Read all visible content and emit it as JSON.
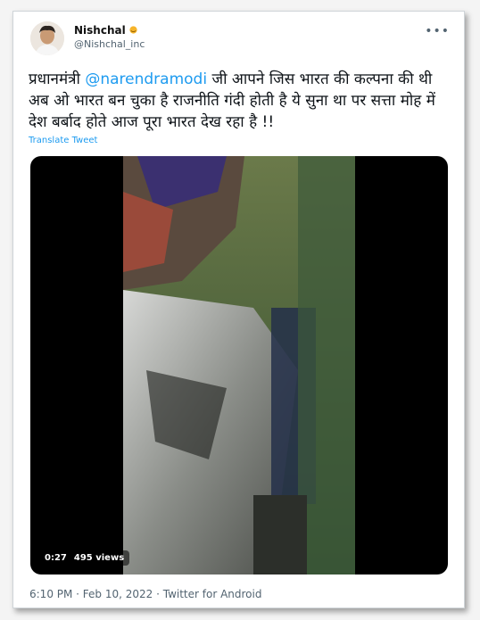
{
  "tweet": {
    "display_name": "Nishchal",
    "handle": "@Nishchal_inc",
    "more_label": "•••",
    "text_before": "प्रधानमंत्री ",
    "mention": "@narendramodi",
    "text_after": "  जी आपने जिस भारत की कल्पना की थी अब ओ भारत बन चुका है राजनीति गंदी होती है ये सुना था पर सत्ता मोह में देश बर्बाद होते आज पूरा भारत देख रहा है !!",
    "translate_label": "Translate Tweet",
    "video": {
      "duration": "0:27",
      "views": "495 views"
    },
    "footer": "6:10 PM · Feb 10, 2022 · Twitter for Android"
  },
  "colors": {
    "link": "#1d9bf0",
    "text": "#0f1419",
    "muted": "#536471"
  },
  "icons": {
    "badge": "sun-emoji-icon",
    "more": "more-options-icon"
  }
}
